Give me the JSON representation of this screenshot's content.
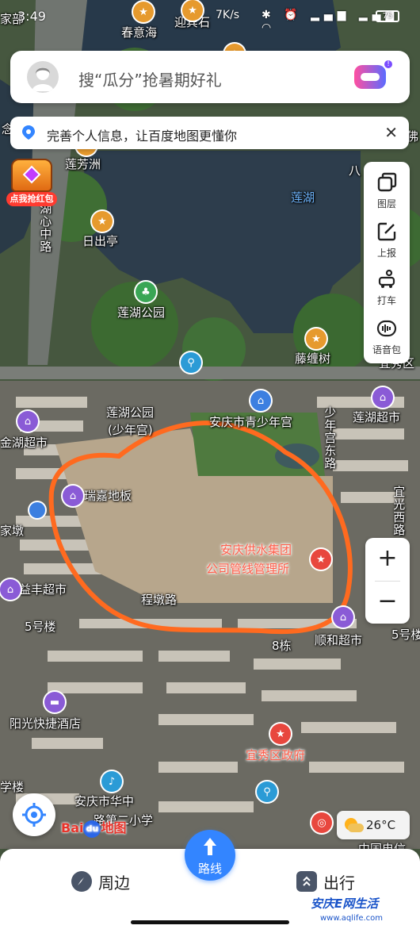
{
  "status_bar": {
    "time": "3:49",
    "network_speed": "7K/s",
    "battery": "75"
  },
  "search": {
    "placeholder": "搜“瓜分”抢暑期好礼"
  },
  "banner": {
    "text": "完善个人信息，让百度地图更懂你",
    "close_icon": "close-icon"
  },
  "red_packet": {
    "caption": "点我抢红包"
  },
  "tools": [
    {
      "name": "layers",
      "label": "图层"
    },
    {
      "name": "report",
      "label": "上报"
    },
    {
      "name": "taxi",
      "label": "打车"
    },
    {
      "name": "voice-pack",
      "label": "语音包"
    }
  ],
  "zoom": {
    "in": "+",
    "out": "−"
  },
  "weather": {
    "temp": "26°C"
  },
  "logo": {
    "text": "Bai",
    "paw": "du",
    "suffix": "地图"
  },
  "bottom_bar": {
    "nearby": "周边",
    "route": "路线",
    "travel": "出行"
  },
  "watermark": {
    "text": "安庆E网生活",
    "url": "www.aqlife.com"
  },
  "map_labels": {
    "top_left_partial": "家部",
    "chunyi_hai": "春意海",
    "yingbin_shi": "迎宾石",
    "lianfang_zhou": "莲芳洲",
    "hu_xin_zhong_lu": "湖心中路",
    "richu_ting": "日出亭",
    "lian_hu": "莲湖",
    "lianhu_park": "莲湖公园",
    "teng_chan_shu": "藤缠树",
    "lianhu_park2": "莲湖公园",
    "shaonian_gong_sub": "(少年宫)",
    "youth_palace": "安庆市青少年宫",
    "shaoniangong_dong_lu": "少年宫东路",
    "lianhu_supermarket": "莲湖超市",
    "jinhu_supermarket": "金湖超市",
    "ruijia_diban": "瑞嘉地板",
    "water_supply": "安庆供水集团",
    "water_supply2": "公司管线管理所",
    "yiguang_xi_lu": "宜光西路",
    "yifeng_supermarket": "益丰超市",
    "chengdu_lu": "程墩路",
    "building5_left": "5号楼",
    "building8": "8栋",
    "shunhe_supermarket": "顺和超市",
    "building5_right": "5号楼",
    "sunshine_hotel": "阳光快捷酒店",
    "yixiu_gov": "宜秀区政府",
    "huazhong_school": "安庆市华中",
    "huazhong_school2": "路第二小学",
    "zhongguo_dianxin": "中国电信",
    "yixiu_qu": "宜秀区",
    "ba_partial": "八",
    "left_edge_a": "念",
    "left_edge_b": "家墩",
    "left_edge_c": "学楼",
    "right_edge_a": "佛"
  }
}
